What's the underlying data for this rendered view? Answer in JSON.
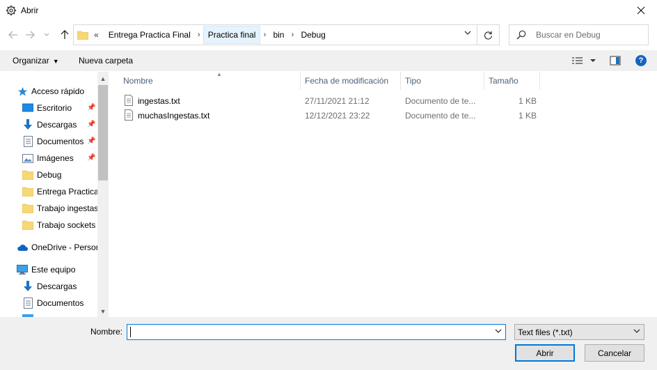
{
  "window": {
    "title": "Abrir",
    "close_icon": "close-icon"
  },
  "address_bar": {
    "overflow_marker": "«",
    "breadcrumbs": [
      "Entrega Practica Final",
      "Practica final",
      "bin",
      "Debug"
    ],
    "highlighted_index": 1
  },
  "search": {
    "placeholder": "Buscar en Debug"
  },
  "toolbar": {
    "organize_label": "Organizar",
    "new_folder_label": "Nueva carpeta"
  },
  "nav_pane": {
    "quick_access": "Acceso rápido",
    "items": [
      {
        "label": "Escritorio",
        "icon": "desktop-icon",
        "pinned": true
      },
      {
        "label": "Descargas",
        "icon": "downloads-icon",
        "pinned": true
      },
      {
        "label": "Documentos",
        "icon": "documents-icon",
        "pinned": true
      },
      {
        "label": "Imágenes",
        "icon": "pictures-icon",
        "pinned": true
      },
      {
        "label": "Debug",
        "icon": "folder-icon",
        "pinned": false
      },
      {
        "label": "Entrega Practica",
        "icon": "folder-icon",
        "pinned": false
      },
      {
        "label": "Trabajo ingestas",
        "icon": "folder-icon",
        "pinned": false
      },
      {
        "label": "Trabajo sockets",
        "icon": "folder-icon",
        "pinned": false
      }
    ],
    "onedrive": "OneDrive - Persor",
    "this_pc": "Este equipo",
    "pc_items": [
      {
        "label": "Descargas",
        "icon": "downloads-icon"
      },
      {
        "label": "Documentos",
        "icon": "documents-icon"
      }
    ]
  },
  "file_list": {
    "columns": [
      "Nombre",
      "Fecha de modificación",
      "Tipo",
      "Tamaño"
    ],
    "rows": [
      {
        "name": "ingestas.txt",
        "modified": "27/11/2021 21:12",
        "type": "Documento de te...",
        "size": "1 KB"
      },
      {
        "name": "muchasIngestas.txt",
        "modified": "12/12/2021 23:22",
        "type": "Documento de te...",
        "size": "1 KB"
      }
    ]
  },
  "footer": {
    "name_label": "Nombre:",
    "name_value": "",
    "file_type": "Text files (*.txt)",
    "open_label": "Abrir",
    "cancel_label": "Cancelar"
  },
  "colors": {
    "accent": "#0078d7",
    "folder": "#f8d775",
    "header_text": "#4c607a"
  }
}
